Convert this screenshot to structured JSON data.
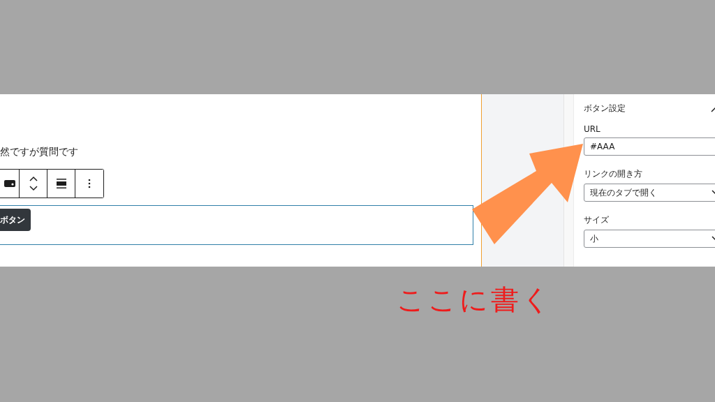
{
  "editor": {
    "paragraph": "然ですが質問です",
    "toolbar": [
      {
        "kind": "style"
      },
      {
        "kind": "move"
      },
      {
        "kind": "align"
      },
      {
        "kind": "more"
      }
    ],
    "button_block": {
      "label": "ボタン"
    }
  },
  "sidebar": {
    "panel": {
      "title": "ボタン設定",
      "expanded": true,
      "fields": [
        {
          "kind": "text",
          "label": "URL",
          "value": "#AAA"
        },
        {
          "kind": "select",
          "label": "リンクの開き方",
          "value": "現在のタブで開く"
        },
        {
          "kind": "select",
          "label": "サイズ",
          "value": "小"
        }
      ]
    }
  },
  "annotation": {
    "text": "ここに書く"
  }
}
